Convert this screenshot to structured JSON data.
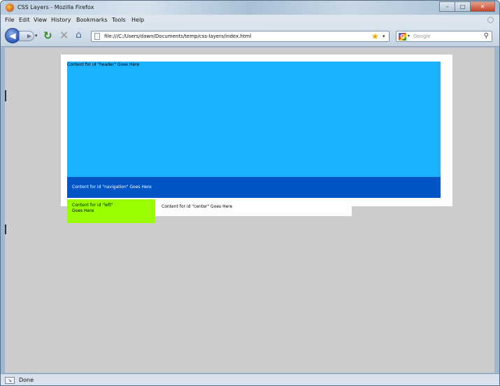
{
  "window": {
    "title": "CSS Layers - Mozilla Firefox",
    "controls": {
      "minimize": "–",
      "maximize": "□",
      "close": "✕"
    }
  },
  "menu": {
    "items": [
      "File",
      "Edit",
      "View",
      "History",
      "Bookmarks",
      "Tools",
      "Help"
    ]
  },
  "toolbar": {
    "back_icon": "back-arrow-icon",
    "forward_icon": "forward-arrow-icon",
    "reload_icon": "reload-icon",
    "stop_icon": "stop-icon",
    "home_icon": "home-icon",
    "url": "file:///C:/Users/dawn/Documents/temp/css-layers/index.html",
    "bookmark_star_icon": "star-icon",
    "search": {
      "engine_icon": "google-icon",
      "placeholder": "Google"
    }
  },
  "page": {
    "header_text": "Content for id \"header\" Goes Here",
    "navigation_text": "Content for id \"navigation\" Goes Here",
    "left_text": "Content for id \"left\" Goes Here",
    "center_text": "Content for id \"center\" Goes Here"
  },
  "colors": {
    "header": "#1ab2ff",
    "navigation": "#0055c7",
    "left": "#99ff00",
    "center": "#ffffff",
    "page_background": "#cccccc"
  },
  "status": {
    "text": "Done"
  }
}
